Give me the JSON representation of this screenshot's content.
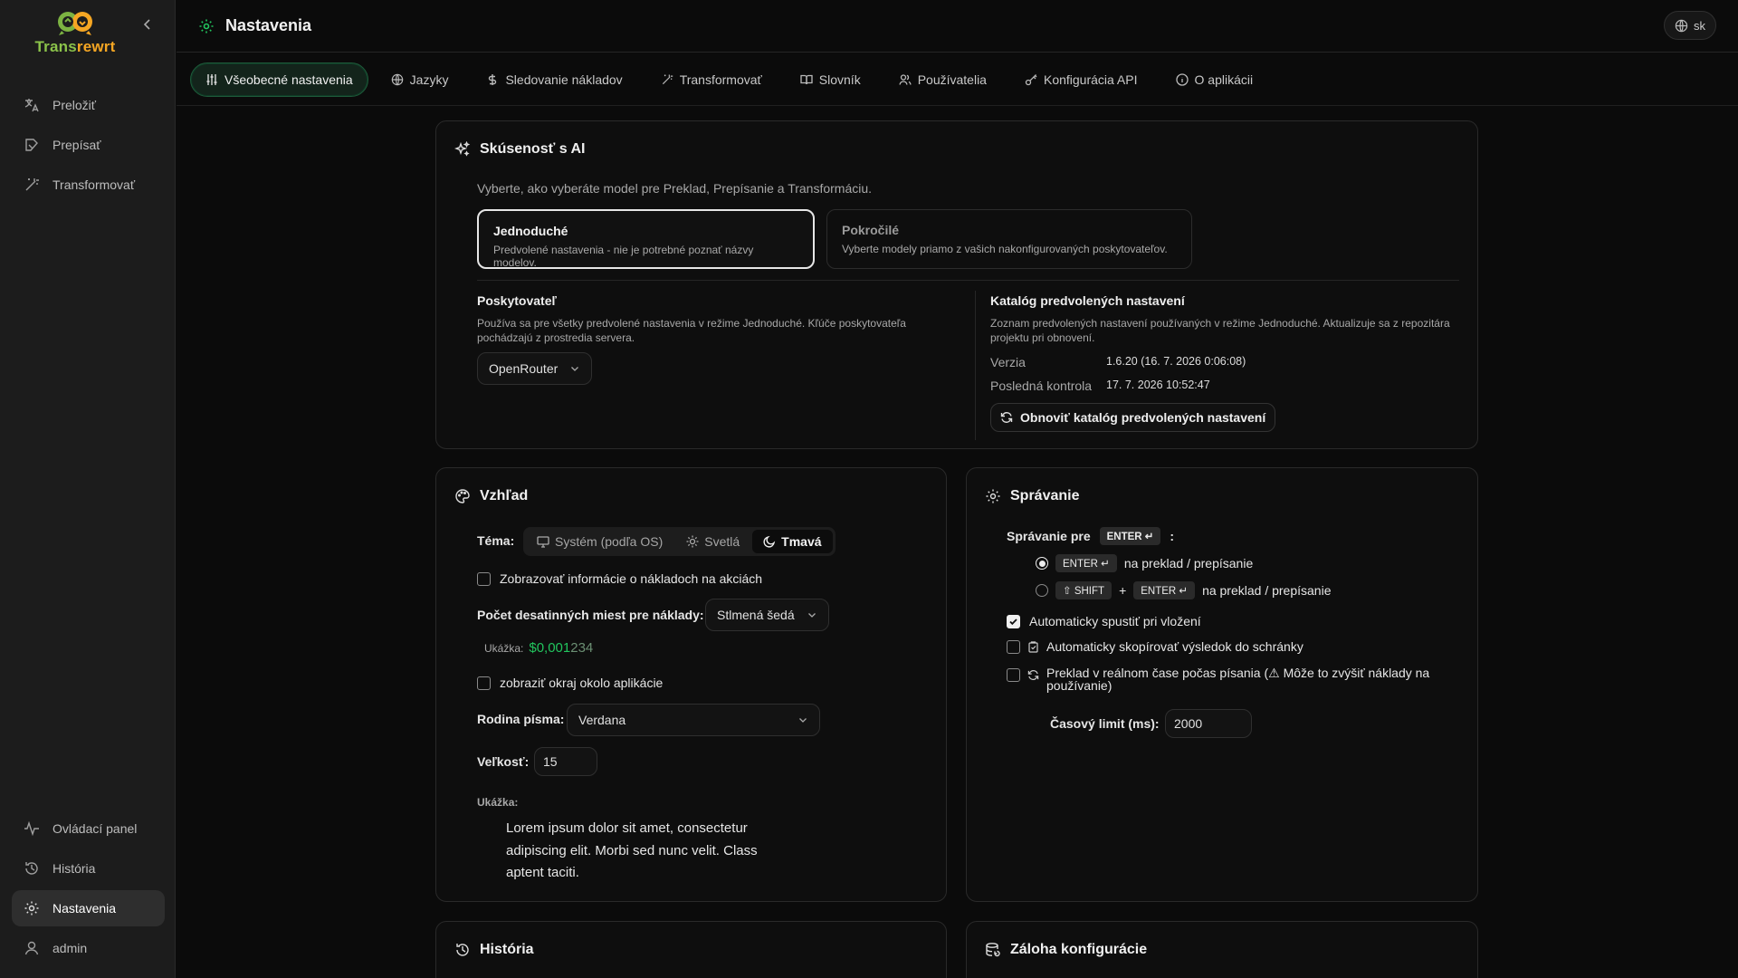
{
  "sidebar": {
    "logo_text_a": "Trans",
    "logo_text_b": "rewrt",
    "items_top": [
      {
        "label": "Preložiť",
        "icon": "translate-icon"
      },
      {
        "label": "Prepísať",
        "icon": "rewrite-icon"
      },
      {
        "label": "Transformovať",
        "icon": "wand-icon"
      }
    ],
    "items_bottom": [
      {
        "label": "Ovládací panel",
        "icon": "activity-icon"
      },
      {
        "label": "História",
        "icon": "history-icon"
      },
      {
        "label": "Nastavenia",
        "icon": "gear-icon",
        "active": true
      },
      {
        "label": "admin",
        "icon": "user-icon"
      }
    ]
  },
  "header": {
    "title": "Nastavenia",
    "lang": "sk"
  },
  "tabs": [
    {
      "label": "Všeobecné nastavenia",
      "icon": "sliders-icon",
      "active": true
    },
    {
      "label": "Jazyky",
      "icon": "globe-icon"
    },
    {
      "label": "Sledovanie nákladov",
      "icon": "dollar-icon"
    },
    {
      "label": "Transformovať",
      "icon": "wand-icon"
    },
    {
      "label": "Slovník",
      "icon": "book-icon"
    },
    {
      "label": "Používatelia",
      "icon": "users-icon"
    },
    {
      "label": "Konfigurácia API",
      "icon": "key-icon"
    },
    {
      "label": "O aplikácii",
      "icon": "info-icon"
    }
  ],
  "ai": {
    "title": "Skúsenosť s AI",
    "description": "Vyberte, ako vyberáte model pre Preklad, Prepísanie a Transformáciu.",
    "mode_simple_title": "Jednoduché",
    "mode_simple_desc": "Predvolené nastavenia - nie je potrebné poznať názvy modelov.",
    "mode_advanced_title": "Pokročilé",
    "mode_advanced_desc": "Vyberte modely priamo z vašich nakonfigurovaných poskytovateľov.",
    "provider_label": "Poskytovateľ",
    "provider_desc": "Používa sa pre všetky predvolené nastavenia v režime Jednoduché. Kľúče poskytovateľa pochádzajú z prostredia servera.",
    "provider_value": "OpenRouter",
    "catalog_title": "Katalóg predvolených nastavení",
    "catalog_desc": "Zoznam predvolených nastavení používaných v režime Jednoduché. Aktualizuje sa z repozitára projektu pri obnovení.",
    "version_label": "Verzia",
    "version_value": "1.6.20 (16. 7. 2026 0:06:08)",
    "last_check_label": "Posledná kontrola",
    "last_check_value": "17. 7. 2026 10:52:47",
    "refresh_button": "Obnoviť katalóg predvolených nastavení"
  },
  "appearance": {
    "title": "Vzhľad",
    "theme_label": "Téma:",
    "theme_options": [
      "Systém (podľa OS)",
      "Svetlá",
      "Tmavá"
    ],
    "theme_selected": "Tmavá",
    "show_costs_label": "Zobrazovať informácie o nákladoch na akciách",
    "decimals_label": "Počet desatinných miest pre náklady:",
    "decimals_value": "Stlmená šedá",
    "sample_label": "Ukážka:",
    "sample_bright": "$0,001",
    "sample_dim": "234",
    "border_label": "zobraziť okraj okolo aplikácie",
    "font_family_label": "Rodina písma:",
    "font_family_value": "Verdana",
    "size_label": "Veľkosť:",
    "size_value": "15",
    "preview_label": "Ukážka:",
    "preview_text": "Lorem ipsum dolor sit amet, consectetur adipiscing elit. Morbi sed nunc velit. Class aptent taciti."
  },
  "behavior": {
    "title": "Správanie",
    "behavior_for": "Správanie pre",
    "enter_key": "ENTER ↵",
    "colon": ":",
    "opt1_text": "na preklad / prepísanie",
    "shift_key": "⇧ SHIFT",
    "plus": "+",
    "opt2_text": "na preklad / prepísanie",
    "auto_run": "Automaticky spustiť pri vložení",
    "auto_copy": "Automaticky skopírovať výsledok do schránky",
    "realtime": "Preklad v reálnom čase počas písania (⚠ Môže to zvýšiť náklady na používanie)",
    "timeout_label": "Časový limit (ms):",
    "timeout_value": "2000"
  },
  "history_card": {
    "title": "História"
  },
  "backup_card": {
    "title": "Záloha konfigurácie"
  },
  "colors": {
    "accent": "#22c55e",
    "logo_green": "#8bc34a",
    "logo_orange": "#f5a623"
  }
}
